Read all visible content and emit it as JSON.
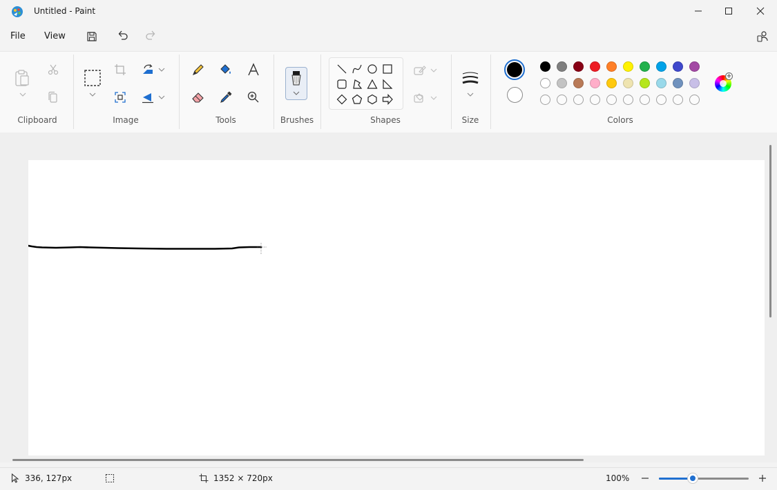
{
  "window": {
    "title": "Untitled - Paint"
  },
  "menu": {
    "file": "File",
    "view": "View"
  },
  "ribbon": {
    "groups": {
      "clipboard": "Clipboard",
      "image": "Image",
      "tools": "Tools",
      "brushes": "Brushes",
      "shapes": "Shapes",
      "size": "Size",
      "colors": "Colors"
    }
  },
  "colors": {
    "primary": "#000000",
    "secondary": "#ffffff",
    "palette_row1": [
      "#000000",
      "#7f7f7f",
      "#880015",
      "#ed1c24",
      "#ff7f27",
      "#fff200",
      "#22b14c",
      "#00a2e8",
      "#3f48cc",
      "#a349a4"
    ],
    "palette_row2": [
      "#ffffff",
      "#c3c3c3",
      "#b97a57",
      "#ffaec9",
      "#ffc90e",
      "#efe4b0",
      "#b5e61d",
      "#99d9ea",
      "#7092be",
      "#c8bfe7"
    ],
    "accent": "#1f6fd0"
  },
  "status": {
    "cursor_position": "336, 127px",
    "canvas_size": "1352 × 720px",
    "zoom": "100%"
  },
  "zoom_level": 0.38
}
